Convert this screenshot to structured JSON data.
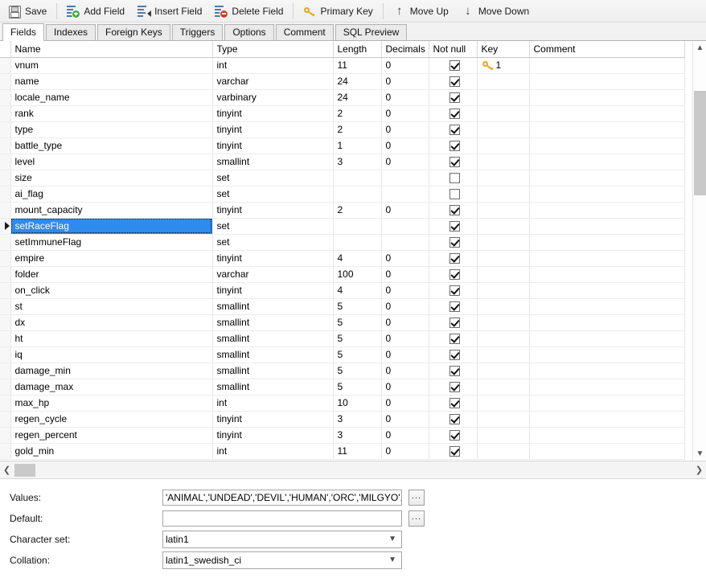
{
  "toolbar": {
    "buttons": [
      {
        "label": "Save",
        "icon": "save-floppy-icon"
      },
      {
        "label": "Add Field",
        "icon": "add-field-icon"
      },
      {
        "label": "Insert Field",
        "icon": "insert-field-icon"
      },
      {
        "label": "Delete Field",
        "icon": "delete-field-icon"
      },
      {
        "label": "Primary Key",
        "icon": "key-icon"
      },
      {
        "label": "Move Up",
        "icon": "arrow-up-icon"
      },
      {
        "label": "Move Down",
        "icon": "arrow-down-icon"
      }
    ]
  },
  "tabs": [
    {
      "label": "Fields",
      "active": true
    },
    {
      "label": "Indexes",
      "active": false
    },
    {
      "label": "Foreign Keys",
      "active": false
    },
    {
      "label": "Triggers",
      "active": false
    },
    {
      "label": "Options",
      "active": false
    },
    {
      "label": "Comment",
      "active": false
    },
    {
      "label": "SQL Preview",
      "active": false
    }
  ],
  "grid": {
    "columns": [
      "Name",
      "Type",
      "Length",
      "Decimals",
      "Not null",
      "Key",
      "Comment"
    ],
    "rows": [
      {
        "name": "vnum",
        "type": "int",
        "length": "11",
        "decimals": "0",
        "not_null": true,
        "key": "1",
        "comment": "",
        "selected": false
      },
      {
        "name": "name",
        "type": "varchar",
        "length": "24",
        "decimals": "0",
        "not_null": true,
        "key": "",
        "comment": "",
        "selected": false
      },
      {
        "name": "locale_name",
        "type": "varbinary",
        "length": "24",
        "decimals": "0",
        "not_null": true,
        "key": "",
        "comment": "",
        "selected": false
      },
      {
        "name": "rank",
        "type": "tinyint",
        "length": "2",
        "decimals": "0",
        "not_null": true,
        "key": "",
        "comment": "",
        "selected": false
      },
      {
        "name": "type",
        "type": "tinyint",
        "length": "2",
        "decimals": "0",
        "not_null": true,
        "key": "",
        "comment": "",
        "selected": false
      },
      {
        "name": "battle_type",
        "type": "tinyint",
        "length": "1",
        "decimals": "0",
        "not_null": true,
        "key": "",
        "comment": "",
        "selected": false
      },
      {
        "name": "level",
        "type": "smallint",
        "length": "3",
        "decimals": "0",
        "not_null": true,
        "key": "",
        "comment": "",
        "selected": false
      },
      {
        "name": "size",
        "type": "set",
        "length": "",
        "decimals": "",
        "not_null": false,
        "key": "",
        "comment": "",
        "selected": false
      },
      {
        "name": "ai_flag",
        "type": "set",
        "length": "",
        "decimals": "",
        "not_null": false,
        "key": "",
        "comment": "",
        "selected": false
      },
      {
        "name": "mount_capacity",
        "type": "tinyint",
        "length": "2",
        "decimals": "0",
        "not_null": true,
        "key": "",
        "comment": "",
        "selected": false
      },
      {
        "name": "setRaceFlag",
        "type": "set",
        "length": "",
        "decimals": "",
        "not_null": true,
        "key": "",
        "comment": "",
        "selected": true
      },
      {
        "name": "setImmuneFlag",
        "type": "set",
        "length": "",
        "decimals": "",
        "not_null": true,
        "key": "",
        "comment": "",
        "selected": false
      },
      {
        "name": "empire",
        "type": "tinyint",
        "length": "4",
        "decimals": "0",
        "not_null": true,
        "key": "",
        "comment": "",
        "selected": false
      },
      {
        "name": "folder",
        "type": "varchar",
        "length": "100",
        "decimals": "0",
        "not_null": true,
        "key": "",
        "comment": "",
        "selected": false
      },
      {
        "name": "on_click",
        "type": "tinyint",
        "length": "4",
        "decimals": "0",
        "not_null": true,
        "key": "",
        "comment": "",
        "selected": false
      },
      {
        "name": "st",
        "type": "smallint",
        "length": "5",
        "decimals": "0",
        "not_null": true,
        "key": "",
        "comment": "",
        "selected": false
      },
      {
        "name": "dx",
        "type": "smallint",
        "length": "5",
        "decimals": "0",
        "not_null": true,
        "key": "",
        "comment": "",
        "selected": false
      },
      {
        "name": "ht",
        "type": "smallint",
        "length": "5",
        "decimals": "0",
        "not_null": true,
        "key": "",
        "comment": "",
        "selected": false
      },
      {
        "name": "iq",
        "type": "smallint",
        "length": "5",
        "decimals": "0",
        "not_null": true,
        "key": "",
        "comment": "",
        "selected": false
      },
      {
        "name": "damage_min",
        "type": "smallint",
        "length": "5",
        "decimals": "0",
        "not_null": true,
        "key": "",
        "comment": "",
        "selected": false
      },
      {
        "name": "damage_max",
        "type": "smallint",
        "length": "5",
        "decimals": "0",
        "not_null": true,
        "key": "",
        "comment": "",
        "selected": false
      },
      {
        "name": "max_hp",
        "type": "int",
        "length": "10",
        "decimals": "0",
        "not_null": true,
        "key": "",
        "comment": "",
        "selected": false
      },
      {
        "name": "regen_cycle",
        "type": "tinyint",
        "length": "3",
        "decimals": "0",
        "not_null": true,
        "key": "",
        "comment": "",
        "selected": false
      },
      {
        "name": "regen_percent",
        "type": "tinyint",
        "length": "3",
        "decimals": "0",
        "not_null": true,
        "key": "",
        "comment": "",
        "selected": false
      },
      {
        "name": "gold_min",
        "type": "int",
        "length": "11",
        "decimals": "0",
        "not_null": true,
        "key": "",
        "comment": "",
        "selected": false
      }
    ]
  },
  "properties": {
    "values_label": "Values:",
    "values_value": "'ANIMAL','UNDEAD','DEVIL','HUMAN','ORC','MILGYO','I",
    "default_label": "Default:",
    "default_value": "",
    "charset_label": "Character set:",
    "charset_value": "latin1",
    "collation_label": "Collation:",
    "collation_value": "latin1_swedish_ci",
    "ellipsis_label": "..."
  },
  "colors": {
    "selection_blue": "#2d8ced",
    "key_gold": "#e5a81e",
    "add_green": "#35ab35",
    "delete_red": "#d63b26",
    "scrollbar_thumb": "#c9c9c9"
  }
}
